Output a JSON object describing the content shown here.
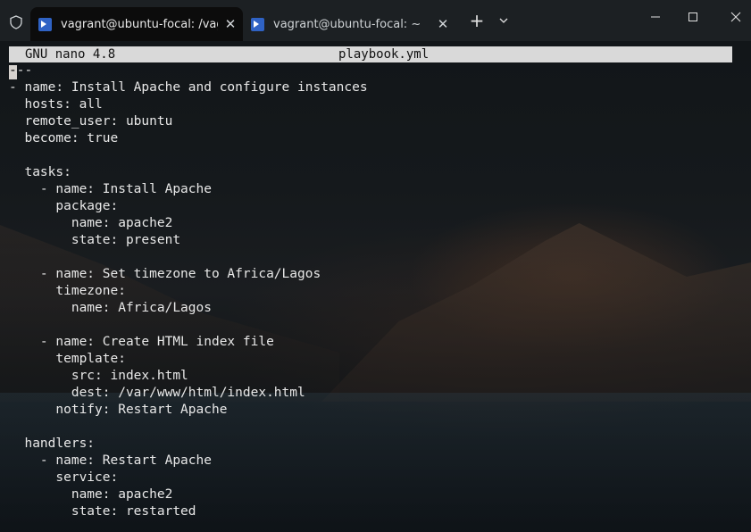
{
  "window": {
    "tabs": [
      {
        "label": "vagrant@ubuntu-focal: /vag",
        "icon": "powershell-icon",
        "active": true
      },
      {
        "label": "vagrant@ubuntu-focal: ~",
        "icon": "powershell-icon",
        "active": false
      }
    ],
    "close_glyph": "✕",
    "new_tab_glyph": "+",
    "dropdown_glyph": "⌵",
    "minimize_glyph": "—",
    "maximize_glyph": "☐",
    "window_close_glyph": "✕",
    "accent": "#2f62c4"
  },
  "nano": {
    "version": "GNU nano 4.8",
    "filename": "playbook.yml",
    "header_bg": "#d9d9d9"
  },
  "file_lines": [
    "---",
    "- name: Install Apache and configure instances",
    "  hosts: all",
    "  remote_user: ubuntu",
    "  become: true",
    "",
    "  tasks:",
    "    - name: Install Apache",
    "      package:",
    "        name: apache2",
    "        state: present",
    "",
    "    - name: Set timezone to Africa/Lagos",
    "      timezone:",
    "        name: Africa/Lagos",
    "",
    "    - name: Create HTML index file",
    "      template:",
    "        src: index.html",
    "        dest: /var/www/html/index.html",
    "      notify: Restart Apache",
    "",
    "  handlers:",
    "    - name: Restart Apache",
    "      service:",
    "        name: apache2",
    "        state: restarted"
  ]
}
